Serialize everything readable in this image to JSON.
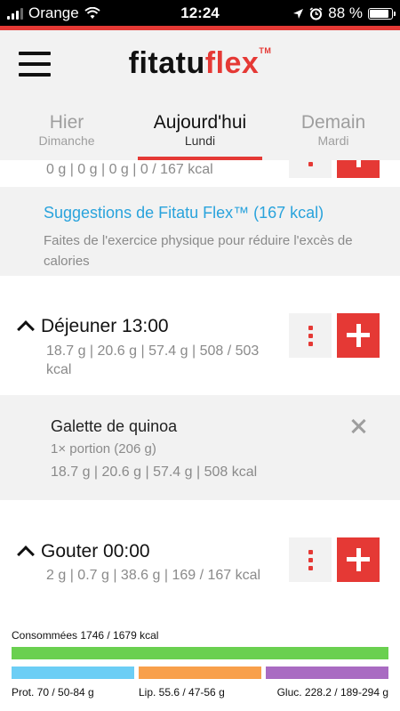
{
  "status_bar": {
    "carrier": "Orange",
    "time": "12:24",
    "battery": "88 %"
  },
  "header": {
    "logo_part1": "fitatu",
    "logo_part2": "flex",
    "logo_tm": "TM"
  },
  "tabs": [
    {
      "label": "Hier",
      "sub": "Dimanche",
      "active": false
    },
    {
      "label": "Aujourd'hui",
      "sub": "Lundi",
      "active": true
    },
    {
      "label": "Demain",
      "sub": "Mardi",
      "active": false
    }
  ],
  "prev_meal": {
    "macros": "0 g | 0 g | 0 g | 0 / 167 kcal"
  },
  "suggestion": {
    "link": "Suggestions de Fitatu Flex™ (167 kcal)",
    "text": "Faites de l'exercice physique pour réduire l'excès de calories"
  },
  "dejeuner": {
    "title": "Déjeuner 13:00",
    "macros": "18.7 g | 20.6 g | 57.4 g | 508 / 503 kcal"
  },
  "food_item": {
    "name": "Galette de quinoa",
    "portion": "1× portion (206 g)",
    "macros": "18.7 g | 20.6 g | 57.4 g | 508 kcal"
  },
  "gouter": {
    "title": "Gouter 00:00",
    "macros": "2 g | 0.7 g | 38.6 g | 169 / 167 kcal"
  },
  "summary": {
    "consumed": "Consommées 1746 / 1679 kcal",
    "prot": "Prot. 70 / 50-84 g",
    "lip": "Lip. 55.6 / 47-56 g",
    "gluc": "Gluc. 228.2 / 189-294 g"
  },
  "colors": {
    "accent": "#e53935",
    "link": "#29a3dc",
    "total_bar": "#6ad050",
    "prot_bar": "#6ccef5",
    "lip_bar": "#f8a04b",
    "gluc_bar": "#a96bc2"
  },
  "icons": {
    "menu": "hamburger-icon",
    "more": "vertical-dots-icon",
    "add": "plus-icon",
    "remove": "close-icon",
    "collapse": "chevron-up-icon"
  }
}
